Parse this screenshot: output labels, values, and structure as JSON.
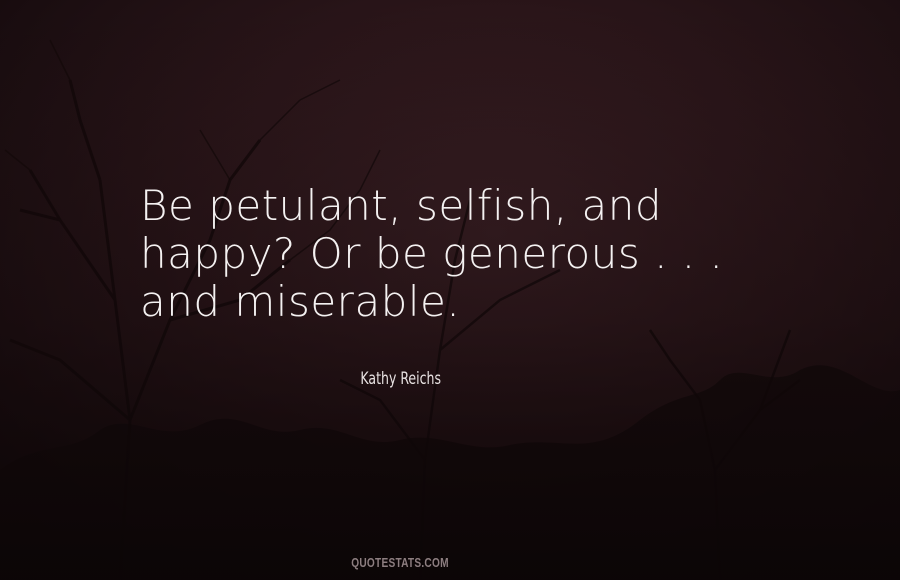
{
  "quote": {
    "lines": [
      "Be petulant, selfish, and",
      "happy? Or be generous . . .",
      "and miserable."
    ],
    "author": "Kathy Reichs"
  },
  "watermark": "QUOTESTATS.COM",
  "colors": {
    "background": "#2a1519",
    "text": "#f4f1f1",
    "tree_silhouette": "#0f0708"
  }
}
